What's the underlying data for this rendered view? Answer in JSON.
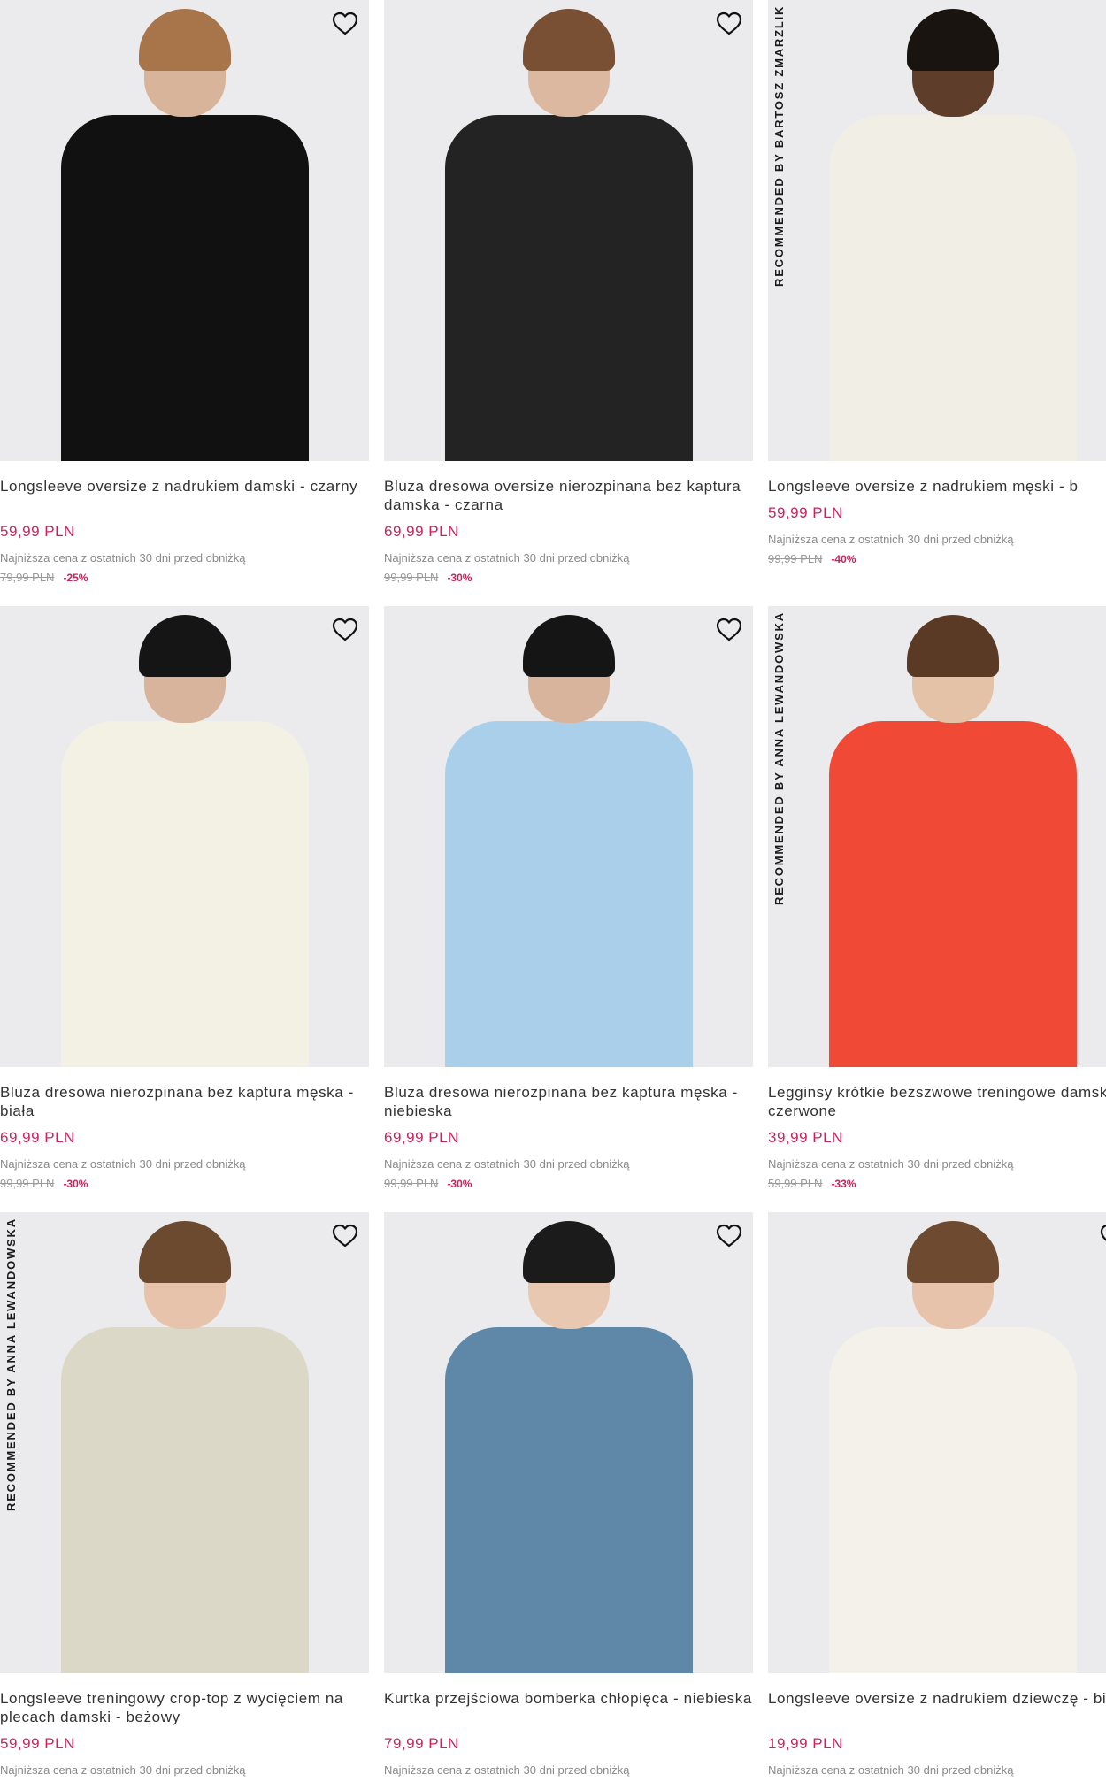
{
  "colors": {
    "price": "#c8245a",
    "image_bg": "#ebebed",
    "text": "#333333",
    "muted": "#8a8a8a"
  },
  "products": [
    {
      "name": "Longsleeve oversize z nadrukiem damski - czarny",
      "price": "59,99 PLN",
      "lowest_label": "Najniższa cena z ostatnich 30 dni przed obniżką",
      "old_price": "79,99 PLN",
      "discount": "-25%",
      "badge": "",
      "wishlist_icon": "heart-icon",
      "look": {
        "hair": "#a8754a",
        "body": "#111111",
        "skin": "#d8b49a"
      }
    },
    {
      "name": "Bluza dresowa oversize nierozpinana bez kaptura damska - czarna",
      "price": "69,99 PLN",
      "lowest_label": "Najniższa cena z ostatnich 30 dni przed obniżką",
      "old_price": "99,99 PLN",
      "discount": "-30%",
      "badge": "",
      "wishlist_icon": "heart-icon",
      "look": {
        "hair": "#7a5034",
        "body": "#232323",
        "skin": "#dcb8a0"
      }
    },
    {
      "name": "Longsleeve oversize z nadrukiem męski - b",
      "price": "59,99 PLN",
      "lowest_label": "Najniższa cena z ostatnich 30 dni przed obniżką",
      "old_price": "99,99 PLN",
      "discount": "-40%",
      "badge": "RECOMMENDED BY BARTOSZ ZMARZLIK",
      "wishlist_icon": "heart-icon",
      "look": {
        "hair": "#1a1410",
        "body": "#f1eee6",
        "skin": "#5e3d2a"
      }
    },
    {
      "name": "Bluza dresowa nierozpinana bez kaptura męska - biała",
      "price": "69,99 PLN",
      "lowest_label": "Najniższa cena z ostatnich 30 dni przed obniżką",
      "old_price": "99,99 PLN",
      "discount": "-30%",
      "badge": "",
      "wishlist_icon": "heart-icon",
      "look": {
        "hair": "#151515",
        "body": "#f3f0e4",
        "skin": "#d9b49c"
      }
    },
    {
      "name": "Bluza dresowa nierozpinana bez kaptura męska - niebieska",
      "price": "69,99 PLN",
      "lowest_label": "Najniższa cena z ostatnich 30 dni przed obniżką",
      "old_price": "99,99 PLN",
      "discount": "-30%",
      "badge": "",
      "wishlist_icon": "heart-icon",
      "look": {
        "hair": "#151515",
        "body": "#a9cfea",
        "skin": "#d9b49c"
      }
    },
    {
      "name": "Legginsy krótkie bezszwowe treningowe damskie - czerwone",
      "price": "39,99 PLN",
      "lowest_label": "Najniższa cena z ostatnich 30 dni przed obniżką",
      "old_price": "59,99 PLN",
      "discount": "-33%",
      "badge": "RECOMMENDED BY ANNA LEWANDOWSKA",
      "wishlist_icon": "heart-icon",
      "look": {
        "hair": "#5a3a24",
        "body": "#f04a36",
        "skin": "#e4c2a8"
      }
    },
    {
      "name": "Longsleeve treningowy crop-top z wycięciem na plecach damski - beżowy",
      "price": "59,99 PLN",
      "lowest_label": "Najniższa cena z ostatnich 30 dni przed obniżką",
      "old_price": "",
      "discount": "",
      "badge": "RECOMMENDED BY ANNA LEWANDOWSKA",
      "wishlist_icon": "heart-icon",
      "look": {
        "hair": "#6b4a30",
        "body": "#dcd8c8",
        "skin": "#e6c3aa"
      }
    },
    {
      "name": "Kurtka przejściowa bomberka chłopięca - niebieska",
      "price": "79,99 PLN",
      "lowest_label": "Najniższa cena z ostatnich 30 dni przed obniżką",
      "old_price": "",
      "discount": "",
      "badge": "",
      "wishlist_icon": "heart-icon",
      "look": {
        "hair": "#1b1b1b",
        "body": "#5f87a8",
        "skin": "#e8c8b0"
      }
    },
    {
      "name": "Longsleeve oversize z nadrukiem dziewczę - biały",
      "price": "19,99 PLN",
      "lowest_label": "Najniższa cena z ostatnich 30 dni przed obniżką",
      "old_price": "",
      "discount": "",
      "badge": "",
      "wishlist_icon": "heart-icon",
      "look": {
        "hair": "#6e4a30",
        "body": "#f4f1ea",
        "skin": "#e6c3aa"
      }
    }
  ]
}
